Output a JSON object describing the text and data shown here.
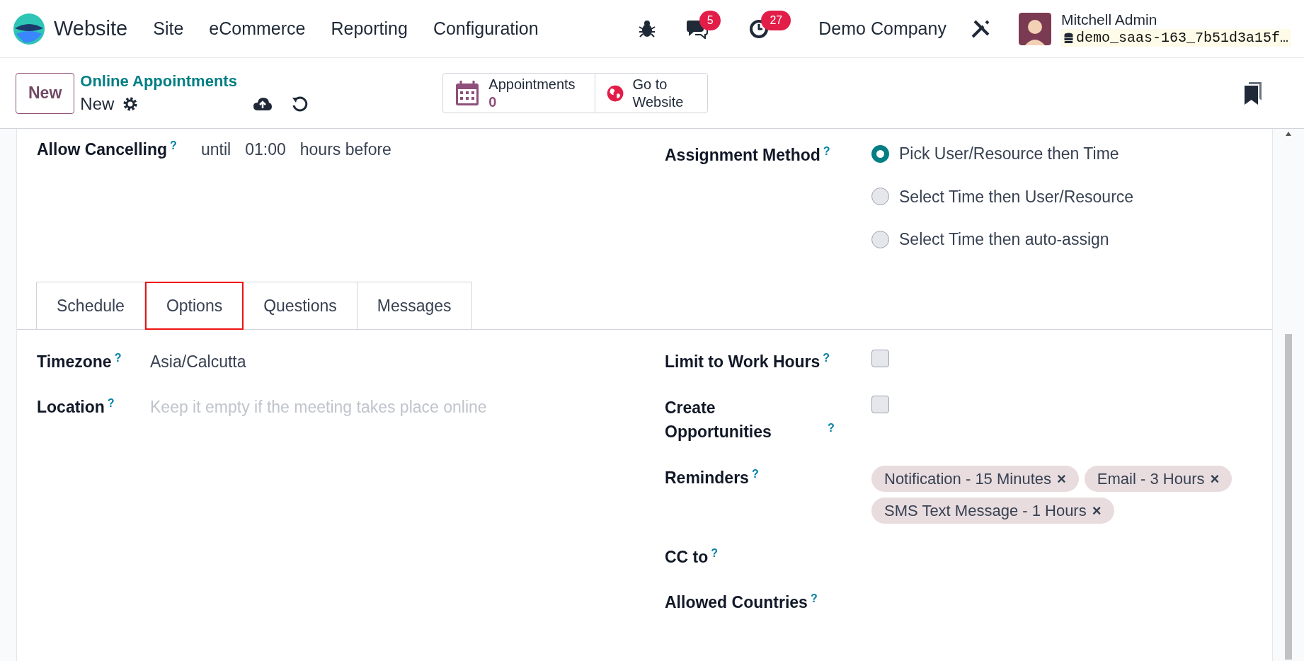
{
  "navbar": {
    "app": "Website",
    "menus": [
      "Site",
      "eCommerce",
      "Reporting",
      "Configuration"
    ],
    "messages_count": "5",
    "activities_count": "27",
    "company": "Demo Company",
    "user": "Mitchell Admin",
    "database": "demo_saas-163_7b51d3a15f…"
  },
  "control_panel": {
    "new_button": "New",
    "breadcrumb": "Online Appointments",
    "record": "New",
    "smart_buttons": [
      {
        "kind": "calendar",
        "label": "Appointments",
        "value": "0"
      },
      {
        "kind": "globe",
        "label": "Go to Website"
      }
    ]
  },
  "header_fields": {
    "allow_cancelling": {
      "label": "Allow Cancelling",
      "help": "?",
      "parts": [
        "until",
        "01:00",
        "hours before"
      ]
    },
    "assignment_method": {
      "label": "Assignment Method",
      "help": "?",
      "options": [
        {
          "label": "Pick User/Resource then Time",
          "selected": true
        },
        {
          "label": "Select Time then User/Resource",
          "selected": false
        },
        {
          "label": "Select Time then auto-assign",
          "selected": false
        }
      ]
    }
  },
  "tabs": [
    {
      "label": "Schedule",
      "selected": false
    },
    {
      "label": "Options",
      "selected": true
    },
    {
      "label": "Questions",
      "selected": false
    },
    {
      "label": "Messages",
      "selected": false
    }
  ],
  "left_fields": [
    {
      "kind": "value",
      "label": "Timezone",
      "help": "?",
      "value": "Asia/Calcutta"
    },
    {
      "kind": "placeholder",
      "label": "Location",
      "help": "?",
      "placeholder": "Keep it empty if the meeting takes place online"
    }
  ],
  "right_fields": [
    {
      "kind": "checkbox",
      "label": "Limit to Work Hours",
      "help": "?",
      "checked": false
    },
    {
      "kind": "checkbox",
      "label": "Create Opportunities",
      "help": "?",
      "checked": false
    },
    {
      "kind": "tags",
      "label": "Reminders",
      "help": "?",
      "tags": [
        "Notification - 15 Minutes",
        "Email - 3 Hours",
        "SMS Text Message - 1 Hours"
      ],
      "remove": "×"
    },
    {
      "kind": "empty",
      "label": "CC to",
      "help": "?"
    },
    {
      "kind": "empty",
      "label": "Allowed Countries",
      "help": "?"
    }
  ]
}
